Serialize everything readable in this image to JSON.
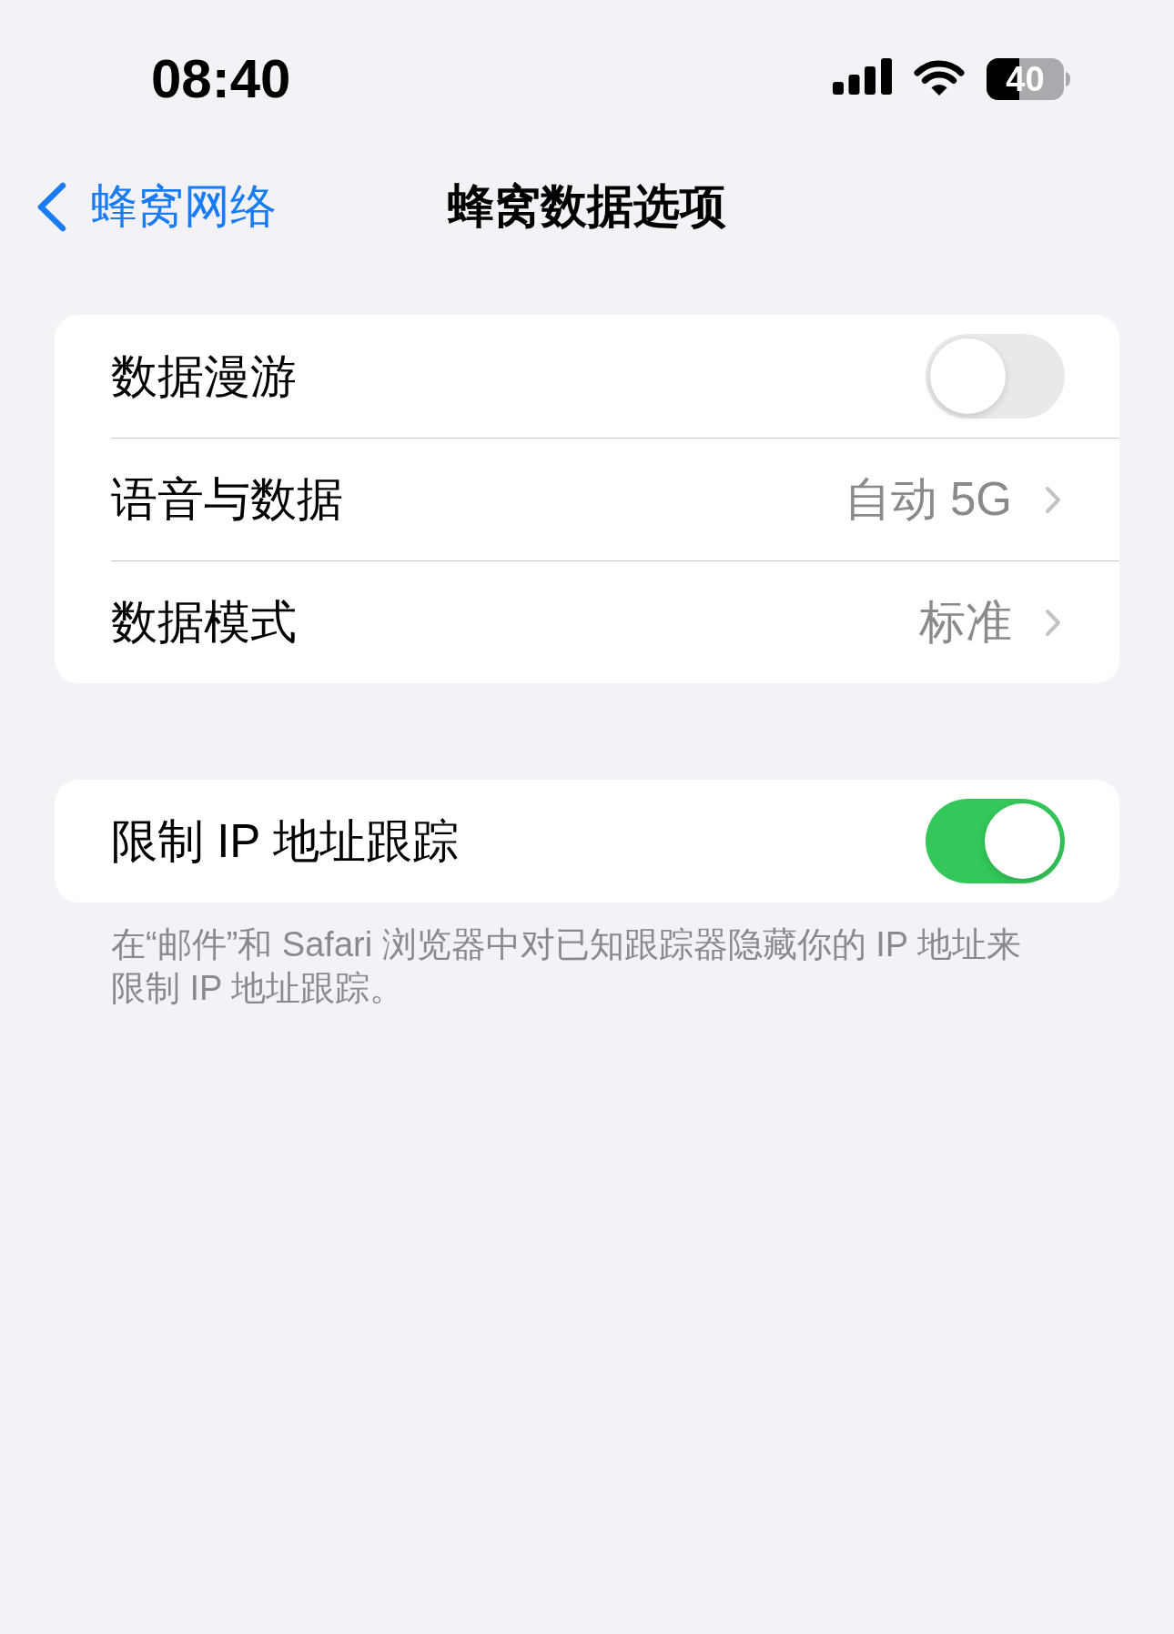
{
  "status_bar": {
    "time": "08:40",
    "battery": "40"
  },
  "nav": {
    "back": "蜂窝网络",
    "title": "蜂窝数据选项"
  },
  "sections": [
    {
      "rows": [
        {
          "kind": "toggle",
          "label": "数据漫游",
          "on": false
        },
        {
          "kind": "link",
          "label": "语音与数据",
          "value": "自动 5G"
        },
        {
          "kind": "link",
          "label": "数据模式",
          "value": "标准"
        }
      ]
    },
    {
      "rows": [
        {
          "kind": "toggle",
          "label": "限制 IP 地址跟踪",
          "on": true
        }
      ],
      "footer": "在“邮件”和 Safari 浏览器中对已知跟踪器隐藏你的 IP 地址来限制 IP 地址跟踪。"
    }
  ]
}
